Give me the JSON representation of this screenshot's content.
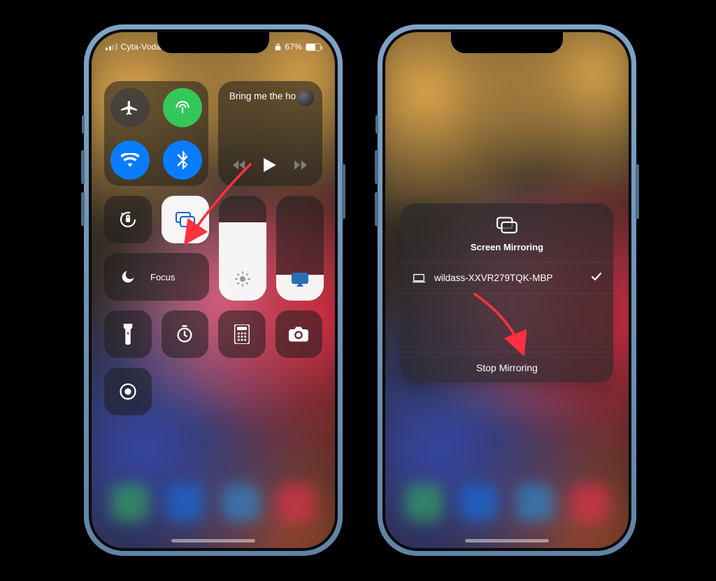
{
  "statusbar": {
    "carrier": "Cyta-Voda",
    "battery_pct": "67%"
  },
  "media": {
    "title": "Bring me the ho…"
  },
  "focus": {
    "label": "Focus"
  },
  "mirroring": {
    "title": "Screen Mirroring",
    "device": "wildass-XXVR279TQK-MBP",
    "stop": "Stop Mirroring"
  },
  "icons": {
    "airplane": "airplane-icon",
    "cellular": "cellular-data-icon",
    "wifi": "wifi-icon",
    "bluetooth": "bluetooth-icon",
    "rotation": "rotation-lock-icon",
    "screen_mirroring": "screen-mirroring-icon",
    "moon": "do-not-disturb-icon",
    "brightness": "brightness-icon",
    "volume_airplay": "airplay-icon",
    "flashlight": "flashlight-icon",
    "timer": "timer-icon",
    "calculator": "calculator-icon",
    "camera": "camera-icon",
    "record": "screen-record-icon",
    "laptop": "laptop-icon",
    "check": "checkmark-icon",
    "play": "play-icon",
    "prev": "previous-track-icon",
    "next": "next-track-icon",
    "lock": "lock-icon"
  },
  "colors": {
    "blue_accent": "#0a7cff",
    "arrow": "#ff3040"
  }
}
